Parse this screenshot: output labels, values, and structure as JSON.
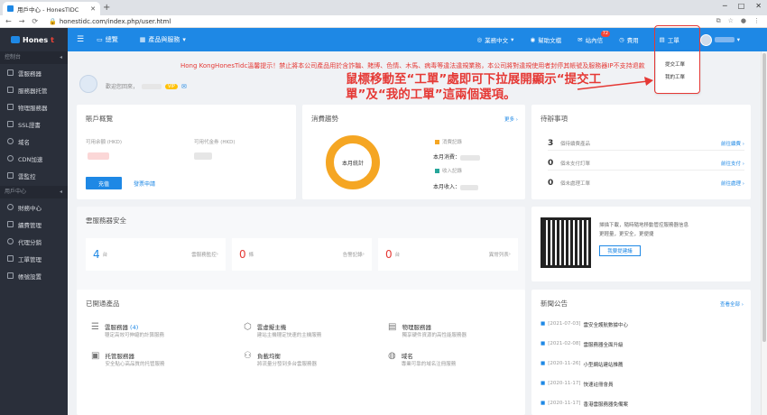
{
  "browser": {
    "tab_title": "用戶中心 - HonesTIDC",
    "url": "honestidc.com/index.php/user.html"
  },
  "topbar": {
    "brand_prefix": "Hones",
    "brand_suffix": "t",
    "nav": [
      "總覽",
      "產品與服務"
    ],
    "right": [
      {
        "label": "業務中文"
      },
      {
        "label": "幫助文檔"
      },
      {
        "label": "站內信",
        "badge": "72"
      },
      {
        "label": "費用"
      },
      {
        "label": "工單"
      }
    ]
  },
  "sidebar": {
    "section1": "控制台",
    "items1": [
      "雲服務器",
      "服務器托管",
      "物理服務器",
      "SSL證書",
      "域名",
      "CDN加速",
      "雲監控"
    ],
    "section2": "用戶中心",
    "items2": [
      "財務中心",
      "續費管理",
      "代理分銷",
      "工單管理",
      "帳號設置"
    ]
  },
  "header": {
    "welcome": "歡迎您回來，",
    "vip": "VIP",
    "notice": "Hong KongHonesTidc溫馨提示！禁止將本公司產品用於含詐騙、賭博、色情、木馬、病毒等違法違規業務，本公司將對違規使用者封停其帳號及服務器IP不支持退款"
  },
  "account": {
    "title": "賬戶概覽",
    "balance_label": "可用余額 (HKD)",
    "voucher_label": "可用代金券 (HKD)",
    "recharge": "充值",
    "invoice": "發票申請"
  },
  "spending": {
    "title": "消費趨勢",
    "more": "更多",
    "center": "本月統計",
    "legend1": "消費記錄",
    "legend2": "收入記錄",
    "month_spend": "本月消費：",
    "month_income": "本月收入："
  },
  "todo": {
    "title": "待辦事項",
    "items": [
      {
        "count": "3",
        "label": "個待續費產品",
        "action": "前往續費"
      },
      {
        "count": "0",
        "label": "個未支付訂單",
        "action": "前往支付"
      },
      {
        "count": "0",
        "label": "個未處理工單",
        "action": "前往處理"
      }
    ]
  },
  "security": {
    "title": "雲服務器安全",
    "items": [
      {
        "value": "4",
        "unit": "台",
        "label": "雲服務監控"
      },
      {
        "value": "0",
        "unit": "條",
        "label": "告警記錄"
      },
      {
        "value": "0",
        "unit": "台",
        "label": "異常列表"
      }
    ]
  },
  "promo": {
    "line1": "掃描下載，隨時隨地移動管控服務器信息",
    "line2": "更輕量，更安全，更便捷",
    "button": "我要提建議"
  },
  "products": {
    "title": "已開通產品",
    "items": [
      {
        "name": "雲服務器",
        "count": "(4)",
        "desc": "穩定高效可伸縮的計算服務"
      },
      {
        "name": "雲虛擬主機",
        "desc": "建站主機穩定快速的主機服務"
      },
      {
        "name": "物理服務器",
        "desc": "獨享硬件資源的高性能服務器"
      },
      {
        "name": "托管服務器",
        "desc": "安全貼心高品質的托管服務"
      },
      {
        "name": "負載均衡",
        "desc": "將流量分發到多台雲服務器"
      },
      {
        "name": "域名",
        "desc": "專業可靠的域名注冊服務"
      }
    ]
  },
  "news": {
    "title": "新聞公告",
    "more": "查看全部",
    "items": [
      {
        "date": "[2021-07-03]",
        "title": "雲安全護航數據中心"
      },
      {
        "date": "[2021-02-08]",
        "title": "雲服務器全面升級"
      },
      {
        "date": "[2020-11-26]",
        "title": "小型網站建站推薦"
      },
      {
        "date": "[2020-11-17]",
        "title": "快速註冊會員"
      },
      {
        "date": "[2020-11-17]",
        "title": "香港雲服務器免備案"
      }
    ]
  },
  "dropdown": {
    "items": [
      "提交工單",
      "我的工單"
    ]
  },
  "callout": "鼠標移動至“工單”處即可下拉展開顯示“提交工單”及“我的工單”這兩個選項。"
}
